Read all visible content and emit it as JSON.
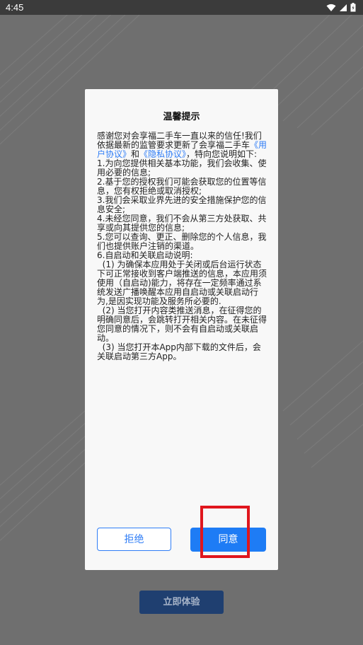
{
  "status_bar": {
    "time": "4:45",
    "icons": [
      "wifi-icon",
      "signal-icon",
      "battery-icon"
    ]
  },
  "dialog": {
    "title": "温馨提示",
    "intro_1": "感谢您对会享福二手车一直以来的信任!我们依据最新的监管要求更新了会享福二手车",
    "user_agreement_link": "《用户协议》",
    "and_text": "和",
    "privacy_link": "《隐私协议》",
    "intro_2": "，特向您说明如下:",
    "items": [
      "1.为向您提供相关基本功能，我们会收集、使用必要的信息;",
      "2.基于您的授权我们可能会获取您的位置等信息，您有权拒绝或取消授权;",
      "3.我们会采取业界先进的安全措施保护您的信息安全;",
      "4.未经您同意，我们不会从第三方处获取、共享或向其提供您的信息;",
      "5.您可以查询、更正、删除您的个人信息，我们也提供账户注销的渠道。",
      "6.自启动和关联启动说明:",
      "  (1) 为确保本应用处于关闭或后台运行状态下可正常接收到客户端推送的信息，本应用须使用（自启动)能力，将存在一定频率通过系统发送广播唤醒本应用自启动或关联启动行为,是因实现功能及服务所必要的.",
      "  (2) 当您打开内容类推送消息，在征得您的明确同意后，会跳转打开相关内容。在未征得您同意的情况下，则不会有自启动或关联启动。",
      "  (3) 当您打开本App内部下载的文件后，会关联启动第三方App。"
    ],
    "reject_label": "拒绝",
    "agree_label": "同意"
  },
  "bottom_button_label": "立即体验",
  "colors": {
    "accent": "#1e7cf5",
    "highlight": "#e0161d",
    "overlay": "#6f6f6f"
  }
}
